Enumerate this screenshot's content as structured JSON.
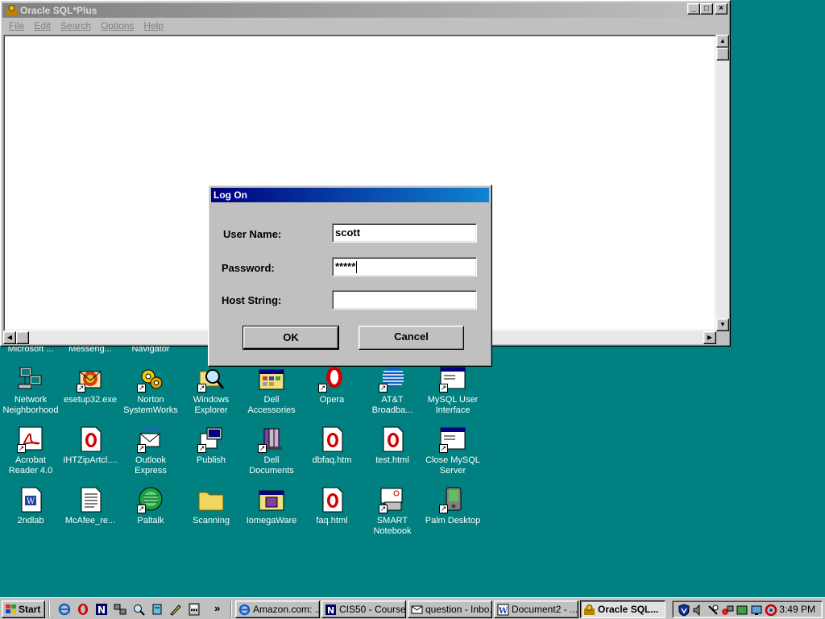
{
  "desktop": {
    "partial_row": [
      {
        "label": "Microsoft ..."
      },
      {
        "label": "Messeng..."
      },
      {
        "label": "Navigator"
      }
    ],
    "icons": [
      {
        "label": "Network\nNeighborhood",
        "icon": "network-icon"
      },
      {
        "label": "esetup32.exe",
        "icon": "setup-icon"
      },
      {
        "label": "Norton\nSystemWorks",
        "icon": "norton-icon"
      },
      {
        "label": "Windows\nExplorer",
        "icon": "explorer-icon"
      },
      {
        "label": "Dell\nAccessories",
        "icon": "folder-window-icon"
      },
      {
        "label": "Opera",
        "icon": "opera-icon"
      },
      {
        "label": "AT&T\nBroadba...",
        "icon": "att-icon"
      },
      {
        "label": "MySQL User\nInterface",
        "icon": "app-window-icon"
      },
      {
        "label": "Acrobat\nReader 4.0",
        "icon": "acrobat-icon"
      },
      {
        "label": "IHTZipArtcl....",
        "icon": "opera-doc-icon"
      },
      {
        "label": "Outlook\nExpress",
        "icon": "outlook-icon"
      },
      {
        "label": "Publish",
        "icon": "publish-icon"
      },
      {
        "label": "Dell\nDocuments",
        "icon": "books-icon"
      },
      {
        "label": "dbfaq.htm",
        "icon": "opera-doc-icon"
      },
      {
        "label": "test.html",
        "icon": "opera-doc-icon"
      },
      {
        "label": "Close MySQL\nServer",
        "icon": "app-window-icon"
      },
      {
        "label": "2ndlab",
        "icon": "word-doc-icon"
      },
      {
        "label": "McAfee_re...",
        "icon": "text-doc-icon"
      },
      {
        "label": "Paltalk",
        "icon": "paltalk-icon"
      },
      {
        "label": "Scanning",
        "icon": "folder-icon"
      },
      {
        "label": "IomegaWare",
        "icon": "iomega-icon"
      },
      {
        "label": "faq.html",
        "icon": "opera-doc-icon"
      },
      {
        "label": "SMART\nNotebook",
        "icon": "smart-icon"
      },
      {
        "label": "Palm Desktop",
        "icon": "palm-icon"
      }
    ]
  },
  "sqlplus": {
    "title": "Oracle SQL*Plus",
    "menu": [
      "File",
      "Edit",
      "Search",
      "Options",
      "Help"
    ],
    "controls": {
      "minimize": "_",
      "maximize": "□",
      "close": "×"
    }
  },
  "logon": {
    "title": "Log On",
    "user_label": "User Name:",
    "user_value": "scott",
    "password_label": "Password:",
    "password_value": "*****",
    "host_label": "Host String:",
    "host_value": "",
    "ok_label": "OK",
    "cancel_label": "Cancel"
  },
  "taskbar": {
    "start_label": "Start",
    "tasks": [
      {
        "label": "Amazon.com: ...",
        "icon": "ie-icon"
      },
      {
        "label": "CIS50 - Course...",
        "icon": "netscape-icon"
      },
      {
        "label": "question - Inbo...",
        "icon": "mail-icon"
      },
      {
        "label": "Document2 - ...",
        "icon": "word-icon"
      },
      {
        "label": "Oracle SQL...",
        "icon": "oracle-icon",
        "active": true
      }
    ],
    "clock": "3:49 PM",
    "quick_launch_more": "»"
  },
  "colors": {
    "desktop": "#008080",
    "face": "#c0c0c0",
    "active_title": "#000080",
    "inactive_title": "#808080"
  }
}
